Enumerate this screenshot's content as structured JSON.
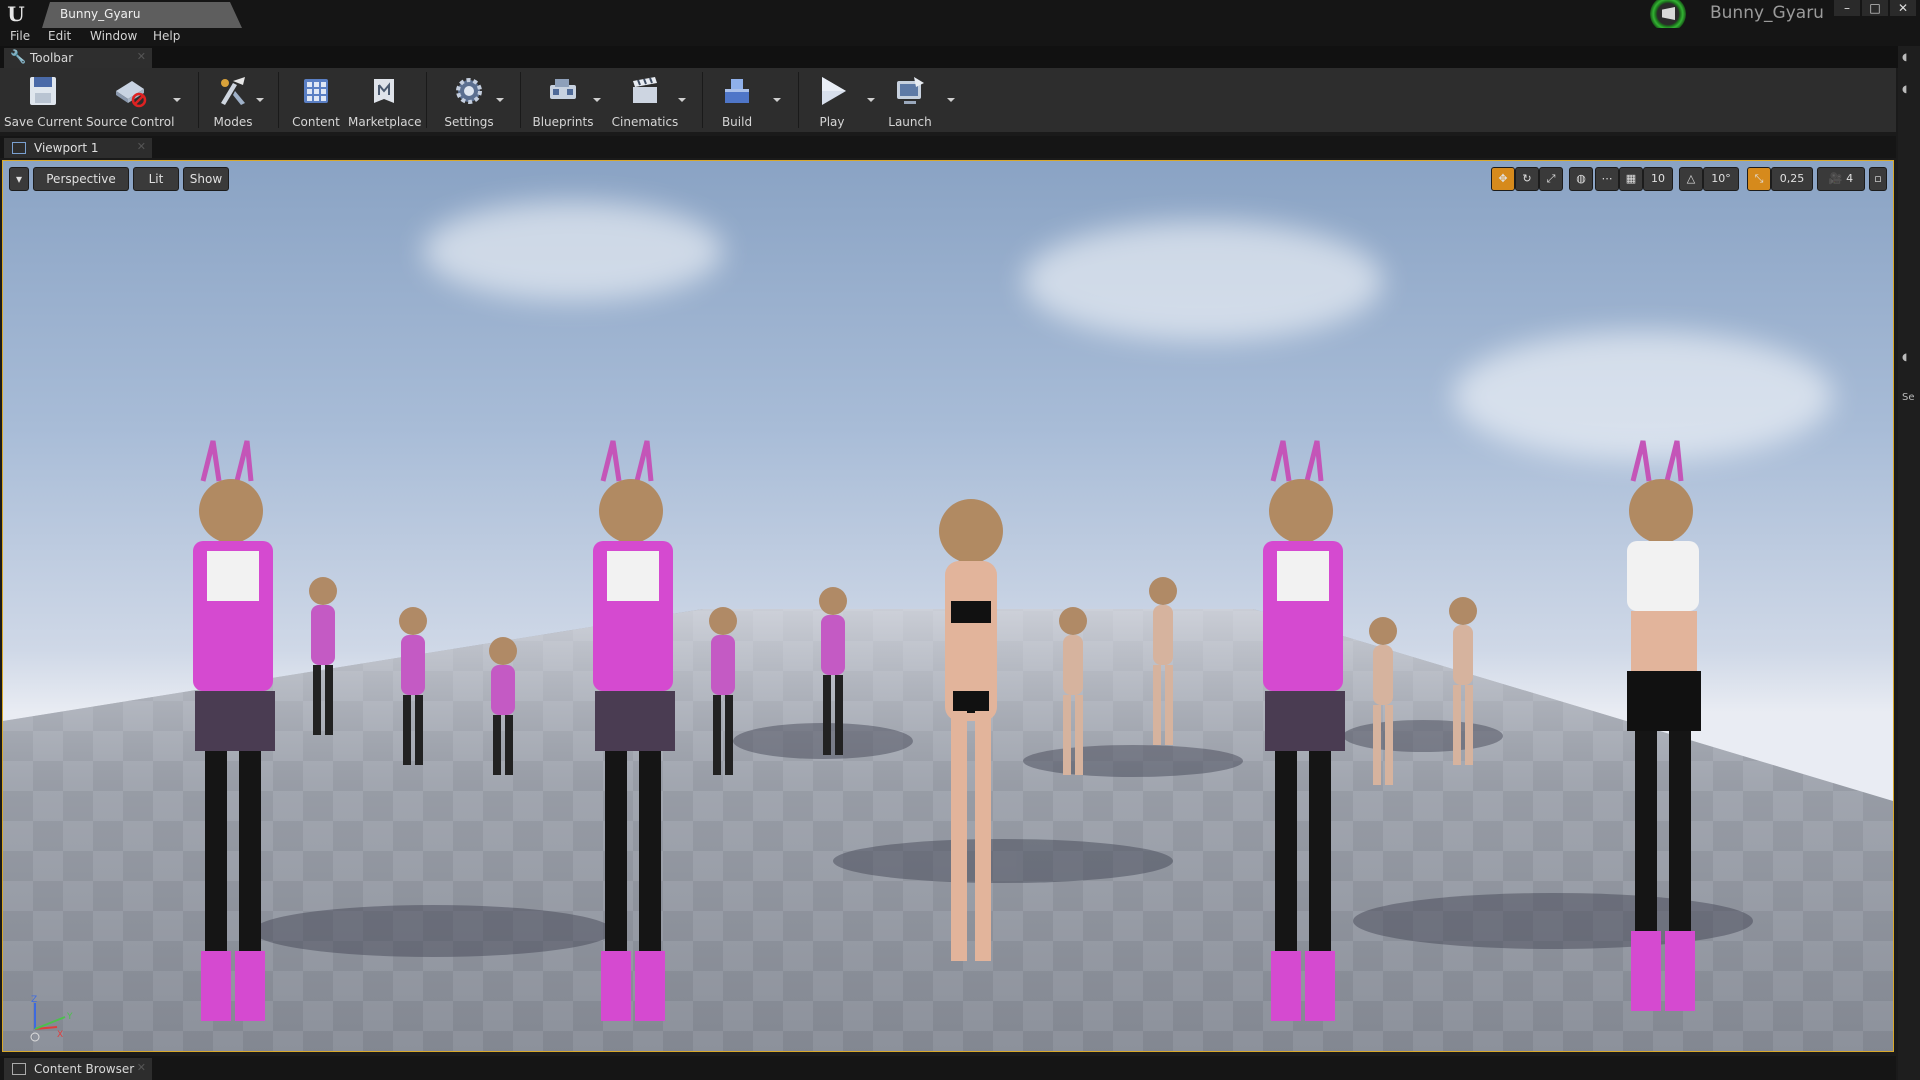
{
  "window": {
    "tab_title": "Bunny_Gyaru",
    "project_name": "Bunny_Gyaru",
    "controls": [
      "–",
      "□",
      "✕"
    ]
  },
  "menu": [
    "File",
    "Edit",
    "Window",
    "Help"
  ],
  "toolbar_tab": {
    "label": "Toolbar"
  },
  "toolbar": {
    "save_current": "Save Current",
    "source_control": "Source Control",
    "modes": "Modes",
    "content": "Content",
    "marketplace": "Marketplace",
    "settings": "Settings",
    "blueprints": "Blueprints",
    "cinematics": "Cinematics",
    "build": "Build",
    "play": "Play",
    "launch": "Launch"
  },
  "viewport_tab": {
    "label": "Viewport 1"
  },
  "viewport": {
    "view_mode": "Perspective",
    "lighting": "Lit",
    "show": "Show",
    "grid_snap": "10",
    "rotation_snap": "10°",
    "scale_snap": "0,25",
    "camera_speed": "4",
    "axis_labels": [
      "Z",
      "X",
      "Y"
    ]
  },
  "right_panel": {
    "cut_text": "Se"
  },
  "content_browser_tab": {
    "label": "Content Browser"
  },
  "colors": {
    "accent_outline": "#d8a82a",
    "snap_active": "#d68a1c",
    "title_bar": "#151515",
    "toolbar": "#2d2d2d"
  },
  "scene": {
    "description_icons": [
      "character-figure"
    ]
  }
}
